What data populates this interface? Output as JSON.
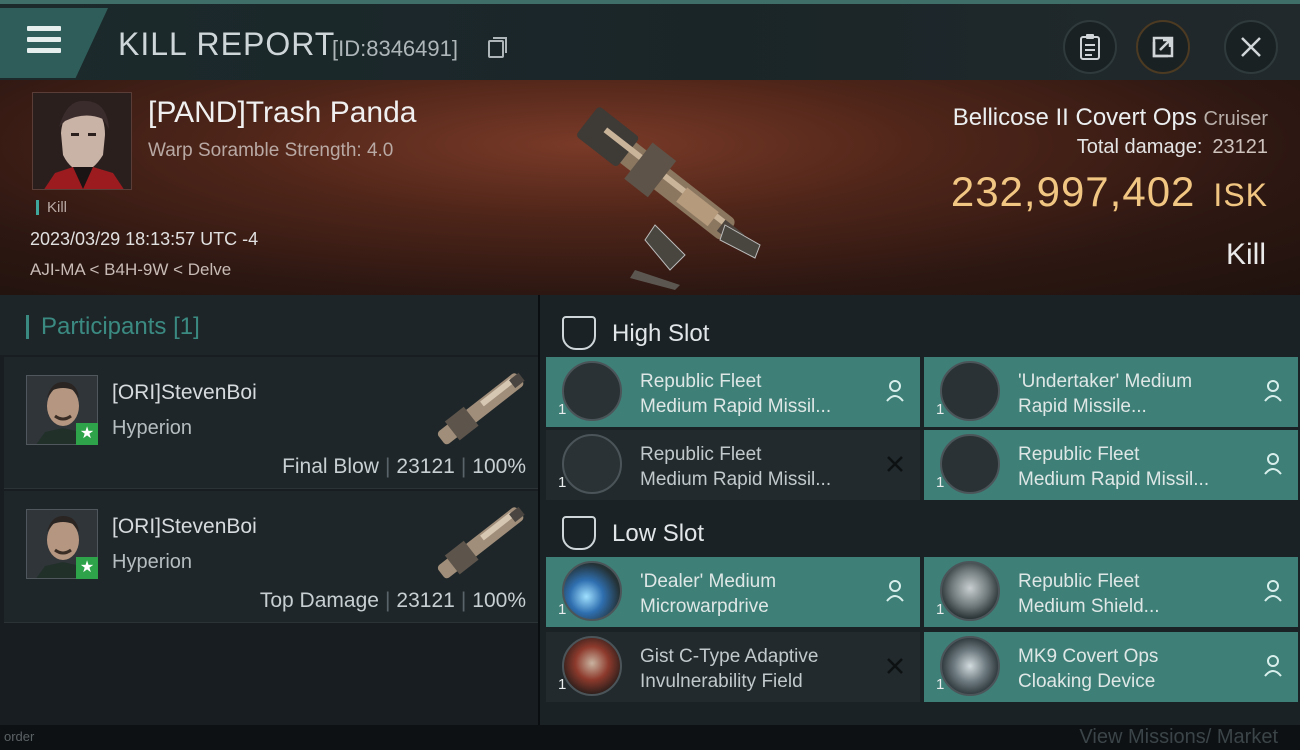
{
  "header": {
    "title": "KILL REPORT",
    "id_label": "[ID:8346491]",
    "menu_icon": "hamburger-icon",
    "buttons": [
      "clipboard-icon",
      "share-icon",
      "close-icon"
    ]
  },
  "victim": {
    "name": "[PAND]Trash Panda",
    "scramble": "Warp Soramble Strength: 4.0",
    "tag": "Kill",
    "time": "2023/03/29 18:13:57 UTC -4",
    "location": "AJI-MA < B4H-9W < Delve",
    "ship_name": "Bellicose II Covert Ops",
    "ship_class": "Cruiser",
    "total_damage_label": "Total damage:",
    "total_damage": "23121",
    "isk_value": "232,997,402",
    "isk_unit": "ISK",
    "kill_type": "Kill"
  },
  "participants": {
    "title": "Participants",
    "count": "[1]",
    "rows": [
      {
        "name": "[ORI]StevenBoi",
        "ship": "Hyperion",
        "role": "Final Blow",
        "damage": "23121",
        "percent": "100%"
      },
      {
        "name": "[ORI]StevenBoi",
        "ship": "Hyperion",
        "role": "Top Damage",
        "damage": "23121",
        "percent": "100%"
      }
    ]
  },
  "fitting": {
    "high_slot_title": "High Slot",
    "low_slot_title": "Low Slot",
    "high": [
      {
        "qty": "1",
        "line1": "Republic Fleet",
        "line2": "Medium Rapid Missil...",
        "state": "fitted"
      },
      {
        "qty": "1",
        "line1": "'Undertaker' Medium",
        "line2": "Rapid Missile...",
        "state": "fitted"
      },
      {
        "qty": "1",
        "line1": "Republic Fleet",
        "line2": "Medium Rapid Missil...",
        "state": "destroyed"
      },
      {
        "qty": "1",
        "line1": "Republic Fleet",
        "line2": "Medium Rapid Missil...",
        "state": "fitted"
      }
    ],
    "low": [
      {
        "qty": "1",
        "line1": "'Dealer' Medium",
        "line2": "Microwarpdrive",
        "state": "fitted"
      },
      {
        "qty": "1",
        "line1": "Republic Fleet",
        "line2": "Medium Shield...",
        "state": "fitted"
      },
      {
        "qty": "1",
        "line1": "Gist C-Type Adaptive",
        "line2": "Invulnerability Field",
        "state": "destroyed"
      },
      {
        "qty": "1",
        "line1": "MK9 Covert Ops",
        "line2": "Cloaking Device",
        "state": "fitted"
      }
    ]
  },
  "footer": {
    "left": "order",
    "right": "View Missions/ Market"
  },
  "colors": {
    "accent": "#3e7f77",
    "isk": "#f1c682",
    "participants_title": "#3b8a82"
  }
}
